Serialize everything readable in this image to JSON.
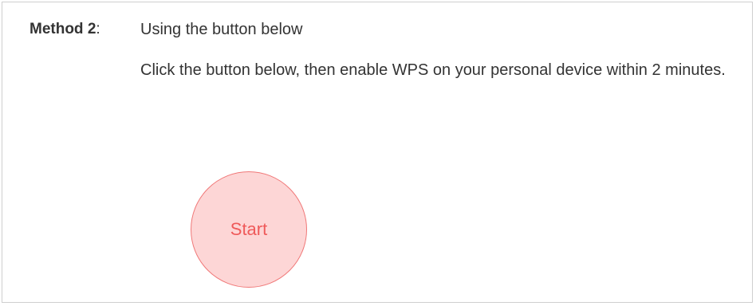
{
  "method": {
    "label": "Method 2",
    "separator": ":",
    "title": "Using the button below"
  },
  "instruction": "Click the button below, then enable WPS on your personal device within 2 minutes.",
  "start_button": {
    "label": "Start"
  },
  "colors": {
    "button_fill": "#fdd6d6",
    "button_border": "#f07878",
    "button_text": "#ef5a5a",
    "text": "#333333",
    "panel_border": "#cfcfcf"
  }
}
